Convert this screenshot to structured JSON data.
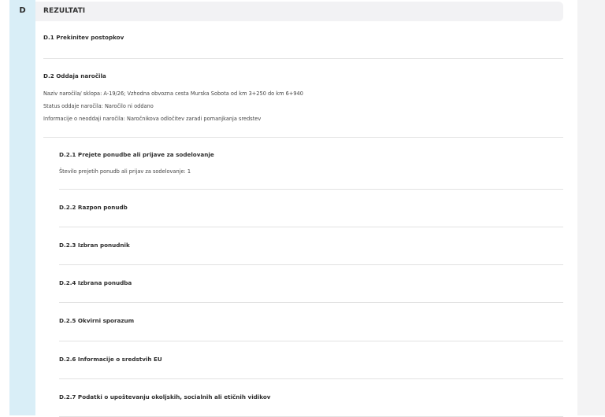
{
  "section": {
    "letter": "D",
    "title": "REZULTATI"
  },
  "d1": {
    "title": "D.1 Prekinitev postopkov"
  },
  "d2": {
    "title": "D.2 Oddaja naročila",
    "lines": [
      "Naziv naročila/ sklopa: A-19/26; Vzhodna obvozna cesta Murska Sobota od km 3+250 do km 6+940",
      "Status oddaje naročila: Naročilo ni oddano",
      "Informacije o neoddaji naročila: Naročnikova odločitev zaradi pomanjkanja sredstev"
    ]
  },
  "subsections": [
    {
      "title": "D.2.1 Prejete ponudbe ali prijave za sodelovanje",
      "detail": "Število prejetih ponudb ali prijav za sodelovanje: 1"
    },
    {
      "title": "D.2.2 Razpon ponudb"
    },
    {
      "title": "D.2.3 Izbran ponudnik"
    },
    {
      "title": "D.2.4 Izbrana ponudba"
    },
    {
      "title": "D.2.5 Okvirni sporazum"
    },
    {
      "title": "D.2.6 Informacije o sredstvih EU"
    },
    {
      "title": "D.2.7 Podatki o upoštevanju okoljskih, socialnih ali etičnih vidikov"
    }
  ]
}
